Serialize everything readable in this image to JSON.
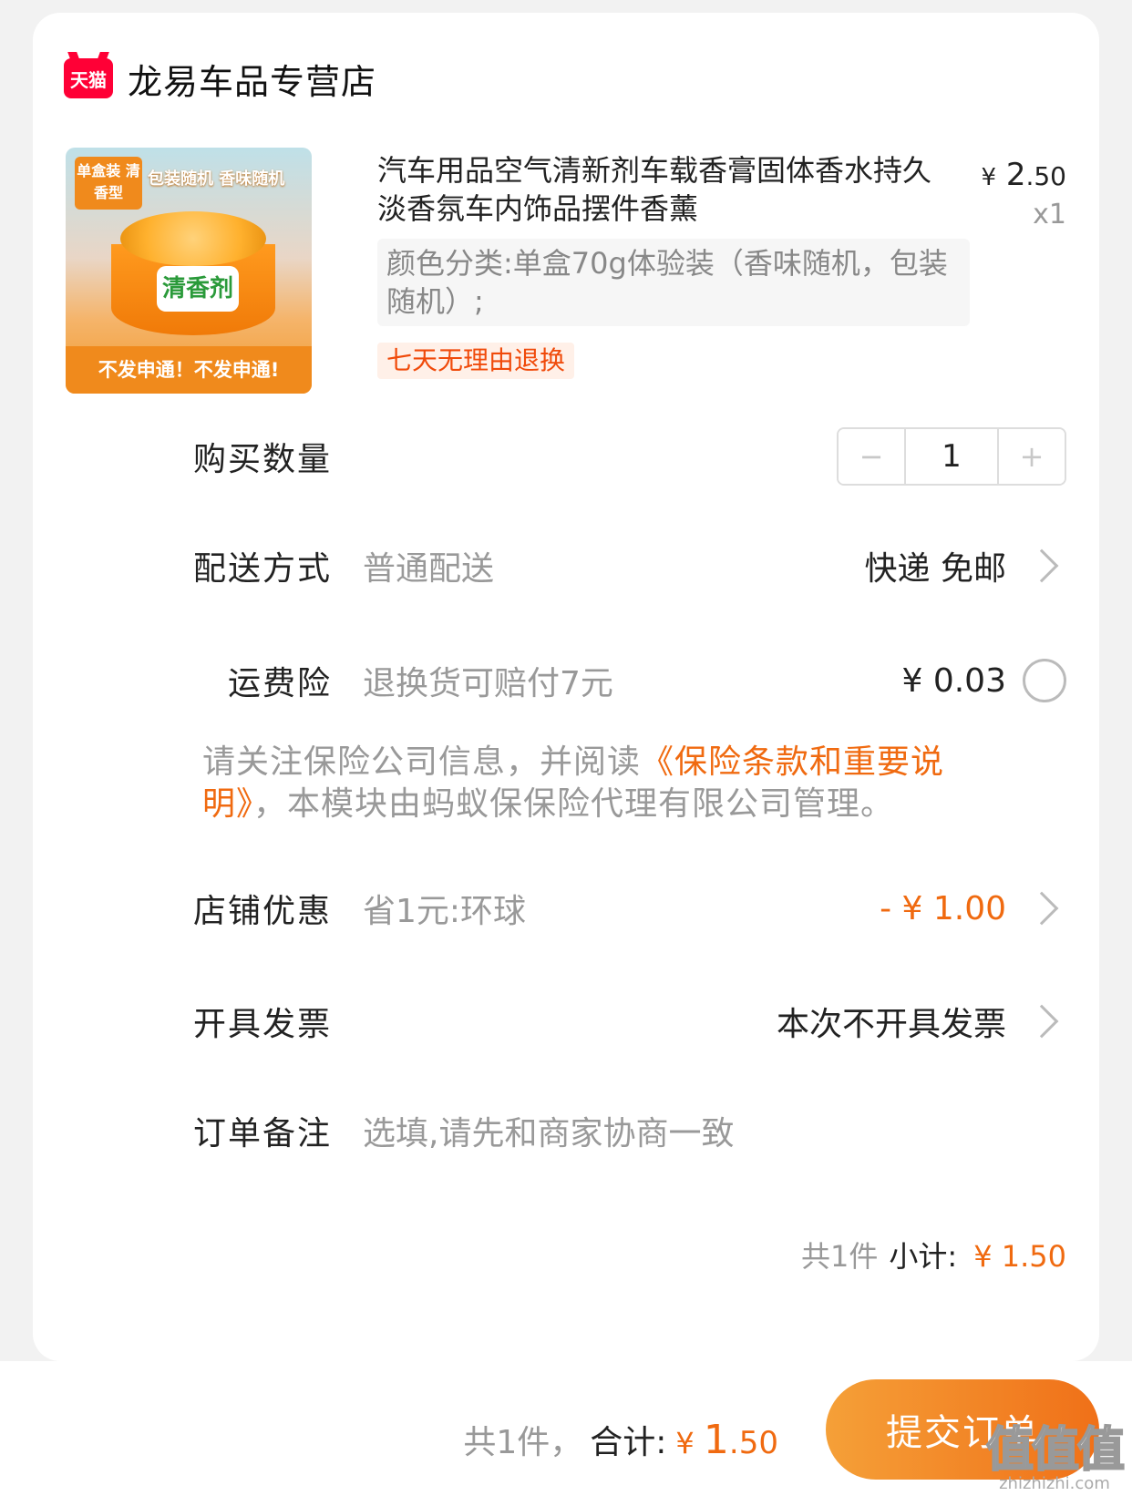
{
  "store": {
    "logo_text": "天猫",
    "name": "龙易车品专营店"
  },
  "product": {
    "image": {
      "tag": "单盒装 清香型",
      "tag2": "包装随机 香味随机",
      "jar_label": "清香剂",
      "bottom_text": "不发申通！不发申通!"
    },
    "title": "汽车用品空气清新剂车载香膏固体香水持久淡香氛车内饰品摆件香薰",
    "price_currency": "¥",
    "price_int": "2",
    "price_dec": ".50",
    "quantity": "x1",
    "sku": "颜色分类:单盒70g体验装（香味随机，包装随机）;",
    "service_tag": "七天无理由退换"
  },
  "purchase_qty": {
    "label": "购买数量",
    "minus": "−",
    "value": "1",
    "plus": "+"
  },
  "delivery": {
    "label": "配送方式",
    "desc": "普通配送",
    "value": "快递 免邮"
  },
  "insurance": {
    "label": "运费险",
    "desc": "退换货可赔付7元",
    "price": "¥ 0.03"
  },
  "notice": {
    "prefix": "请关注保险公司信息，并阅读",
    "link": "《保险条款和重要说明》",
    "suffix": "，本模块由蚂蚁保保险代理有限公司管理。"
  },
  "coupon": {
    "label": "店铺优惠",
    "desc": "省1元:环球",
    "value": "- ¥ 1.00"
  },
  "invoice": {
    "label": "开具发票",
    "value": "本次不开具发票"
  },
  "remark": {
    "label": "订单备注",
    "placeholder": "选填,请先和商家协商一致"
  },
  "subtotal": {
    "count": "共1件",
    "label": "小计:",
    "amount": "¥ 1.50"
  },
  "footer": {
    "count": "共1件，",
    "label": "合计:",
    "currency": "¥ ",
    "amount_int": "1",
    "amount_dec": ".50",
    "submit": "提交订单"
  },
  "watermark": {
    "main": "值值值",
    "sub": "zhizhizhi.com"
  },
  "colors": {
    "accent": "#f06a10",
    "tmall_red": "#ff0036"
  }
}
